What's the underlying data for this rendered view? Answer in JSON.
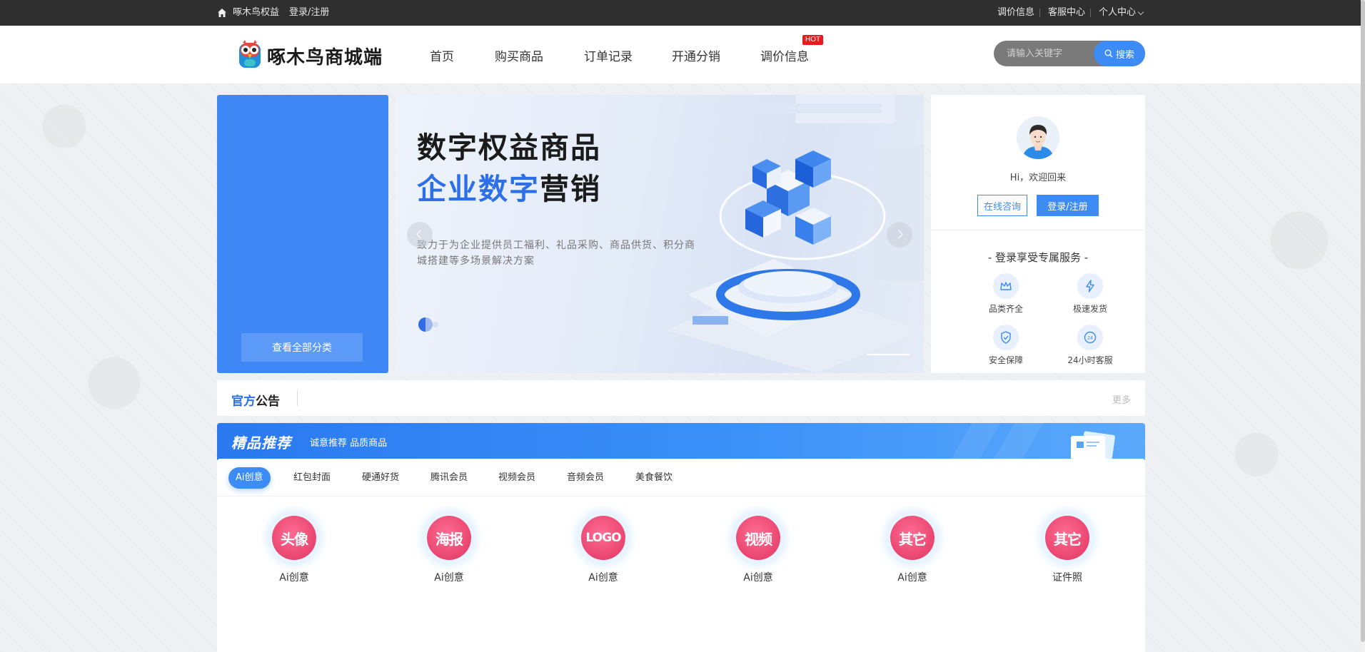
{
  "topbar": {
    "site_name": "啄木鸟权益",
    "login_register": "登录/注册",
    "price_info": "调价信息",
    "service_center": "客服中心",
    "personal_center": "个人中心"
  },
  "header": {
    "logo_text": "啄木鸟商城端",
    "nav": [
      "首页",
      "购买商品",
      "订单记录",
      "开通分销",
      "调价信息"
    ],
    "hot_badge": "HOT",
    "search_placeholder": "请输入关键字",
    "search_button": "搜索"
  },
  "category": {
    "view_all": "查看全部分类"
  },
  "banner": {
    "headline_1": "数字权益商品",
    "headline_2_blue": "企业数字",
    "headline_2_dark": "营销",
    "description": "致力于为企业提供员工福利、礼品采购、商品供货、积分商城搭建等多场景解决方案"
  },
  "user_panel": {
    "greeting": "Hi，欢迎回来",
    "consult_button": "在线咨询",
    "login_button": "登录/注册",
    "service_title": "- 登录享受专属服务 -",
    "services": [
      {
        "label": "品类齐全",
        "icon": "crown-icon"
      },
      {
        "label": "极速发货",
        "icon": "lightning-icon"
      },
      {
        "label": "安全保障",
        "icon": "shield-check-icon"
      },
      {
        "label": "24小时客服",
        "icon": "clock-24-icon"
      }
    ]
  },
  "notice": {
    "label_blue": "官方",
    "label_dark": "公告",
    "more": "更多"
  },
  "featured": {
    "title": "精品推荐",
    "subtitle": "诚意推荐 品质商品",
    "tabs": [
      "Ai创意",
      "红包封面",
      "硬通好货",
      "腾讯会员",
      "视频会员",
      "音频会员",
      "美食餐饮"
    ],
    "active_tab": "Ai创意",
    "products": [
      {
        "icon_text": "头像",
        "label": "Ai创意"
      },
      {
        "icon_text": "海报",
        "label": "Ai创意"
      },
      {
        "icon_text": "LOGO",
        "label": "Ai创意"
      },
      {
        "icon_text": "视频",
        "label": "Ai创意"
      },
      {
        "icon_text": "其它",
        "label": "Ai创意"
      },
      {
        "icon_text": "其它",
        "label": "证件照"
      }
    ]
  },
  "colors": {
    "accent": "#3d8bf4",
    "topbar": "#2f2f2f",
    "product_circle": "#e8456f",
    "hot": "#e11d1d"
  }
}
